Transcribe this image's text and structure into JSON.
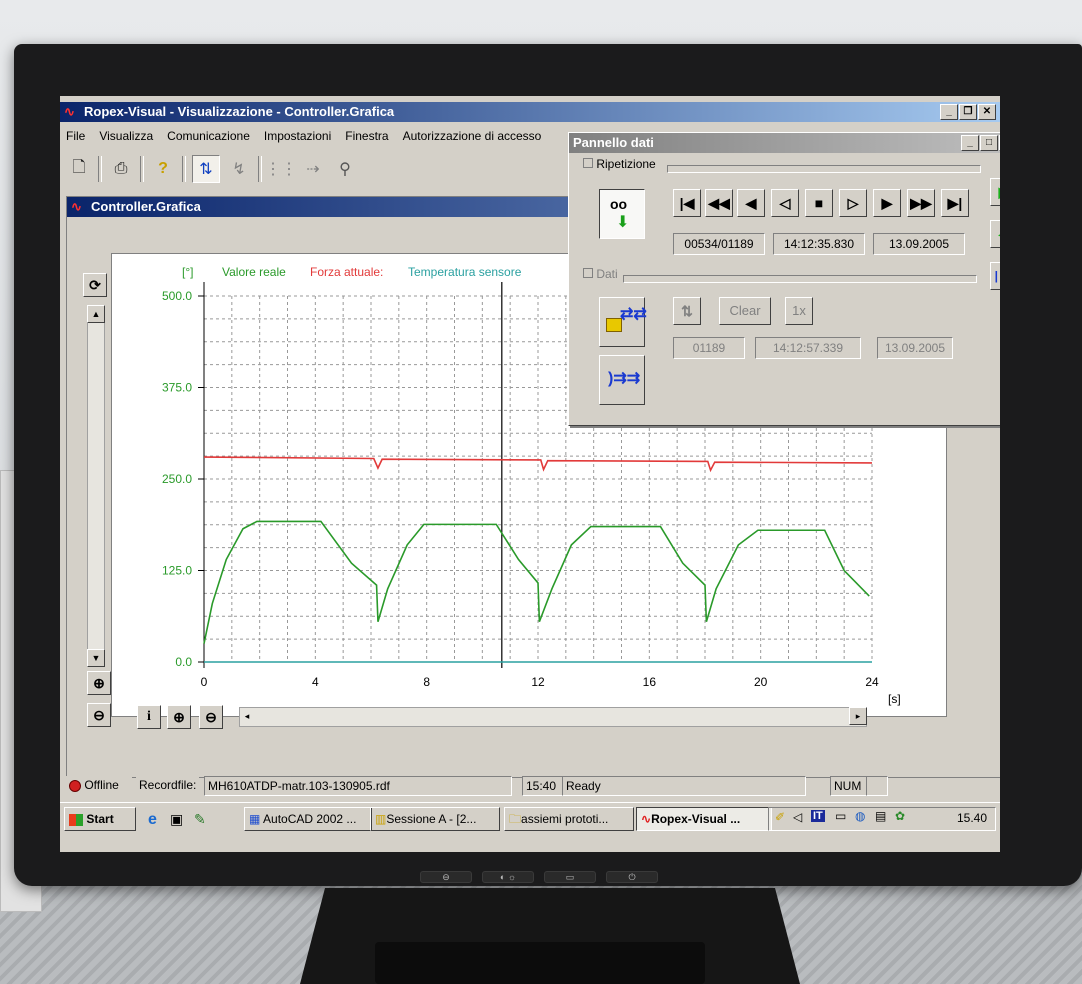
{
  "window": {
    "title": "Ropex-Visual - Visualizzazione - Controller.Grafica",
    "icon": "ropex-icon"
  },
  "menu": [
    "File",
    "Visualizza",
    "Comunicazione",
    "Impostazioni",
    "Finestra",
    "Autorizzazione di accesso"
  ],
  "toolbar": {
    "icons": [
      "new-file-icon",
      "print-icon",
      "help-icon",
      "connect-icon",
      "flash-icon",
      "network-icon",
      "transfer-icon",
      "tools-icon"
    ]
  },
  "mdi": {
    "title": "Controller.Grafica"
  },
  "legend": {
    "actual": "Valore reale",
    "force": "Forza attuale:",
    "temp": "Temperatura sensore"
  },
  "colors": {
    "actual": "#2a9a2a",
    "force": "#e23a3a",
    "temp": "#2aa0a0",
    "title_active": "#0a246a"
  },
  "panel": {
    "title": "Pannello dati",
    "group1": "Ripetizione",
    "group2": "Dati",
    "record": "00534/01189",
    "time": "14:12:35.830",
    "date": "13.09.2005",
    "data_record": "01189",
    "data_time": "14:12:57.339",
    "data_date": "13.09.2005",
    "clear_label": "Clear",
    "x1_label": "1x"
  },
  "status": {
    "offline": "Offline",
    "recordfile_label": "Recordfile:",
    "recordfile": "MH610ATDP-matr.103-130905.rdf",
    "time": "15:40",
    "state": "Ready",
    "num": "NUM"
  },
  "taskbar": {
    "start": "Start",
    "tasks": [
      "AutoCAD 2002 ...",
      "Sessione A - [2...",
      "assiemi prototi...",
      "Ropex-Visual ..."
    ],
    "lang": "IT",
    "clock": "15.40"
  },
  "chart_data": {
    "type": "line",
    "ylabel": "[°]",
    "xlabel": "[s]",
    "xlim": [
      0,
      24
    ],
    "ylim": [
      0,
      500
    ],
    "x_ticks": [
      0,
      4,
      8,
      12,
      16,
      20,
      24
    ],
    "y_ticks": [
      "0.0",
      "125.0",
      "250.0",
      "375.0",
      "500.0"
    ],
    "cursor_x": 10.7,
    "series": [
      {
        "name": "Valore reale",
        "color": "#2a9a2a",
        "x": [
          0,
          0.3,
          0.8,
          1.4,
          1.9,
          4.2,
          5.3,
          6.2,
          6.25,
          6.6,
          7.3,
          7.9,
          10.5,
          11.3,
          12.0,
          12.05,
          12.5,
          13.2,
          13.9,
          16.4,
          17.2,
          18.0,
          18.05,
          18.4,
          19.2,
          19.9,
          22.3,
          23.0,
          23.9
        ],
        "y": [
          25,
          80,
          140,
          182,
          192,
          192,
          135,
          105,
          55,
          100,
          160,
          188,
          188,
          140,
          108,
          55,
          100,
          160,
          185,
          185,
          135,
          105,
          55,
          100,
          160,
          180,
          180,
          125,
          90
        ]
      },
      {
        "name": "Forza attuale:",
        "color": "#e23a3a",
        "x": [
          0,
          6.1,
          6.25,
          6.4,
          12.1,
          12.2,
          12.35,
          18.1,
          18.2,
          18.35,
          24
        ],
        "y": [
          280,
          278,
          265,
          277,
          276,
          263,
          275,
          274,
          262,
          273,
          272
        ]
      },
      {
        "name": "Temperatura sensore",
        "color": "#2aa0a0",
        "x": [
          0,
          24
        ],
        "y": [
          0,
          0
        ]
      }
    ]
  }
}
